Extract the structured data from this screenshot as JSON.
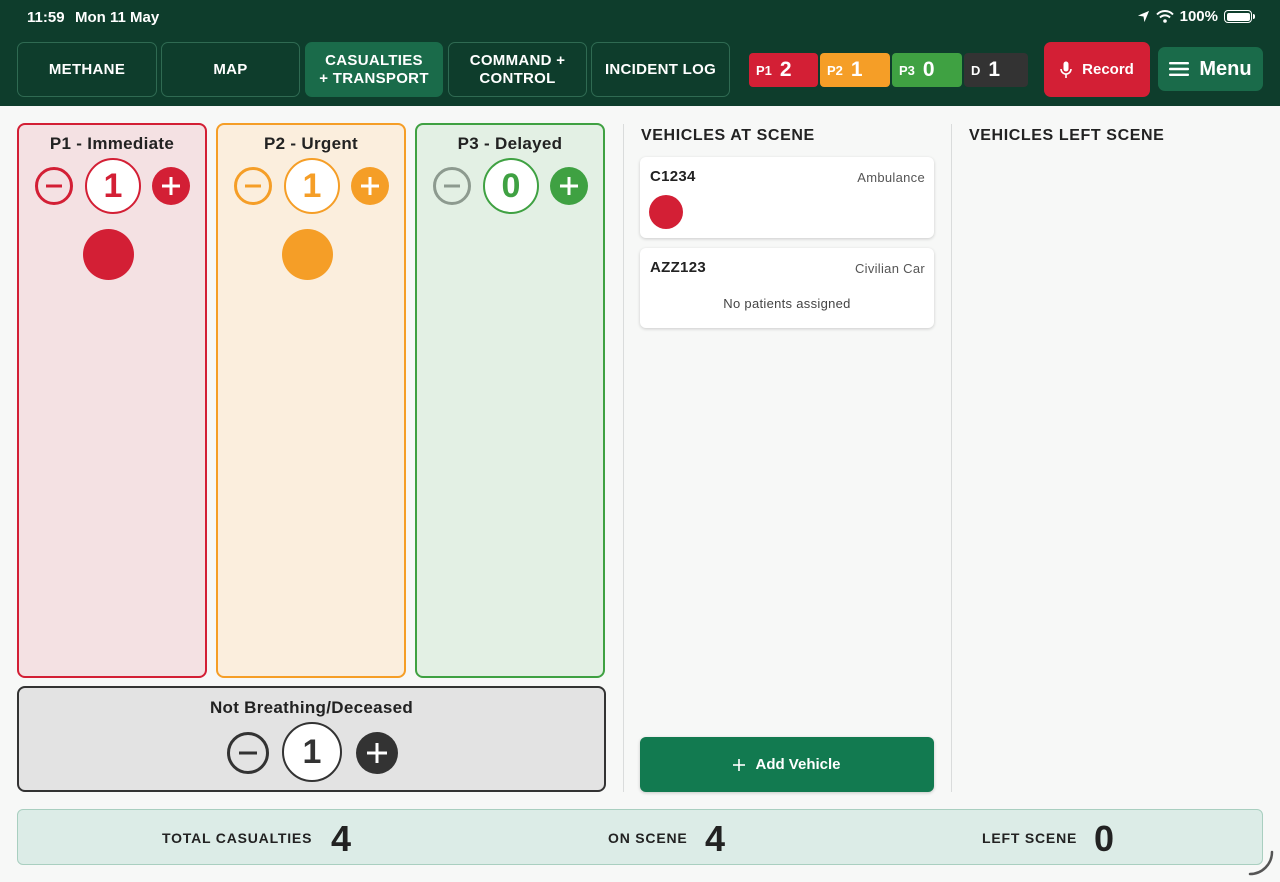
{
  "status_bar": {
    "time": "11:59",
    "date": "Mon 11 May",
    "battery": "100%"
  },
  "tabs": [
    {
      "label": "METHANE",
      "active": false
    },
    {
      "label": "MAP",
      "active": false
    },
    {
      "label": "CASUALTIES + TRANSPORT",
      "active": true
    },
    {
      "label": "COMMAND + CONTROL",
      "active": false
    },
    {
      "label": "INCIDENT LOG",
      "active": false
    }
  ],
  "counts": [
    {
      "label": "P1",
      "value": "2",
      "color": "#d31f35"
    },
    {
      "label": "P2",
      "value": "1",
      "color": "#f59e27"
    },
    {
      "label": "P3",
      "value": "0",
      "color": "#3fa142"
    },
    {
      "label": "D",
      "value": "1",
      "color": "#333333"
    }
  ],
  "record_label": "Record",
  "menu_label": "Menu",
  "triage": {
    "p1": {
      "title": "P1 - Immediate",
      "count": "1",
      "color": "#d31f35",
      "bg": "#f4e1e3"
    },
    "p2": {
      "title": "P2 - Urgent",
      "count": "1",
      "color": "#f59e27",
      "bg": "#fbeedd"
    },
    "p3": {
      "title": "P3 - Delayed",
      "count": "0",
      "color": "#3fa142",
      "bg": "#e3f0e4"
    },
    "deceased": {
      "title": "Not Breathing/Deceased",
      "count": "1",
      "color": "#333333"
    }
  },
  "vehicles_at_scene": {
    "title": "VEHICLES AT SCENE",
    "items": [
      {
        "reg": "C1234",
        "type": "Ambulance",
        "patients": [
          "p1"
        ]
      },
      {
        "reg": "AZZ123",
        "type": "Civilian Car",
        "empty_text": "No patients assigned"
      }
    ],
    "add_label": "Add Vehicle"
  },
  "vehicles_left_scene": {
    "title": "VEHICLES LEFT SCENE"
  },
  "footer": {
    "total_label": "TOTAL CASUALTIES",
    "total_value": "4",
    "on_scene_label": "ON SCENE",
    "on_scene_value": "4",
    "left_label": "LEFT SCENE",
    "left_value": "0"
  }
}
